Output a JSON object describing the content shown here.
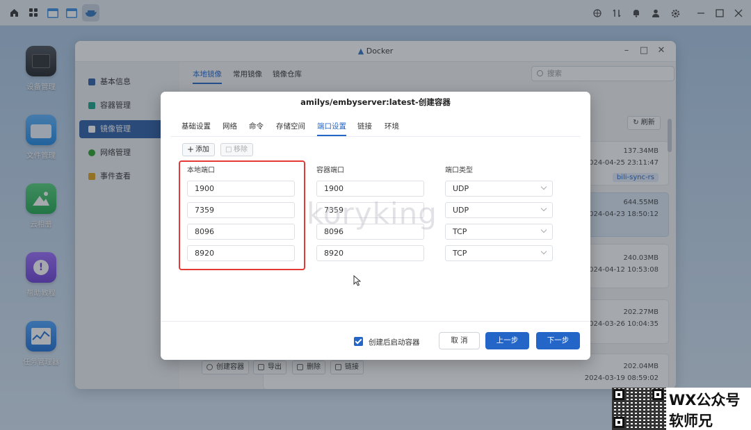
{
  "system_tray": {
    "icons": [
      "network-icon",
      "transfer-icon",
      "bell-icon",
      "user-icon",
      "settings-icon",
      "minimize-icon",
      "maximize-icon",
      "close-icon"
    ]
  },
  "desktop": {
    "icons": [
      {
        "label": "设备管理",
        "icon": "device-icon"
      },
      {
        "label": "文件管理",
        "icon": "folder-icon"
      },
      {
        "label": "云相册",
        "icon": "photo-icon"
      },
      {
        "label": "帮助教程",
        "icon": "help-icon"
      },
      {
        "label": "任务管理器",
        "icon": "task-monitor-icon"
      }
    ]
  },
  "docker_window": {
    "title": "Docker",
    "sidebar": [
      {
        "label": "基本信息"
      },
      {
        "label": "容器管理"
      },
      {
        "label": "镜像管理"
      },
      {
        "label": "网络管理"
      },
      {
        "label": "事件查看"
      }
    ],
    "tabs": [
      "本地镜像",
      "常用镜像",
      "镜像仓库"
    ],
    "search_placeholder": "搜索",
    "refresh_label": "刷新",
    "images": [
      {
        "size": "137.34MB",
        "date": "2024-04-25 23:11:47",
        "tag": "bili-sync-rs"
      },
      {
        "size": "644.55MB",
        "date": "2024-04-23 18:50:12"
      },
      {
        "size": "240.03MB",
        "date": "2024-04-12 10:53:08"
      },
      {
        "size": "202.27MB",
        "date": "2024-03-26 10:04:35"
      },
      {
        "size": "202.04MB",
        "date": "2024-03-19 08:59:02"
      }
    ],
    "bottom_actions": [
      "创建容器",
      "导出",
      "删除",
      "链接"
    ]
  },
  "dialog": {
    "title": "amilys/embyserver:latest-创建容器",
    "tabs": [
      "基础设置",
      "网络",
      "命令",
      "存储空间",
      "端口设置",
      "链接",
      "环境"
    ],
    "add_label": "添加",
    "remove_label": "移除",
    "col_local": "本地端口",
    "col_container": "容器端口",
    "col_type": "端口类型",
    "ports": [
      {
        "local": "1900",
        "container": "1900",
        "type": "UDP"
      },
      {
        "local": "7359",
        "container": "7359",
        "type": "UDP"
      },
      {
        "local": "8096",
        "container": "8096",
        "type": "TCP"
      },
      {
        "local": "8920",
        "container": "8920",
        "type": "TCP"
      }
    ],
    "auto_start_label": "创建后启动容器",
    "cancel_label": "取 消",
    "prev_label": "上一步",
    "next_label": "下一步"
  },
  "watermark": "koryking",
  "wx_line1": "WX公众号",
  "wx_line2": "软师兄"
}
